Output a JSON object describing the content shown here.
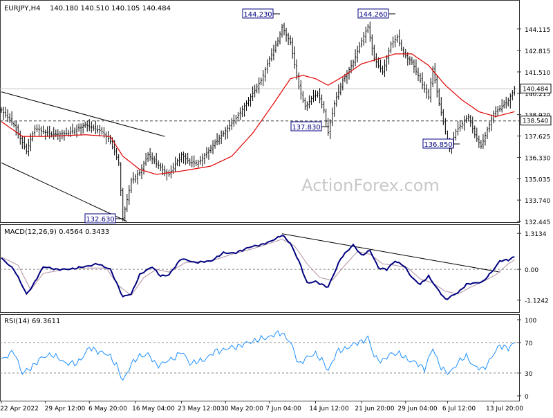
{
  "header": {
    "symbol": "EURJPY,H4",
    "ohlc": "140.180 140.510 140.105 140.484"
  },
  "watermark": "ActionForex.com",
  "colors": {
    "price": "#000000",
    "ma": "#e00000",
    "macd": "#000080",
    "signal": "#b090a0",
    "rsi": "#1e90ff",
    "grid": "#8a8a8a"
  },
  "chart_data": [
    {
      "type": "candlestick",
      "title": "EURJPY,H4  140.180 140.510 140.105 140.484",
      "ylim": [
        132.445,
        144.905
      ],
      "y_ticks": [
        "144.115",
        "142.815",
        "141.510",
        "140.215",
        "138.920",
        "137.625",
        "136.330",
        "135.035",
        "133.740",
        "132.445"
      ],
      "x_ticks": [
        "22 Apr 2022",
        "29 Apr 12:00",
        "6 May 20:00",
        "16 May 04:00",
        "23 May 12:00",
        "30 May 20:00",
        "7 Jun 04:00",
        "14 Jun 12:00",
        "21 Jun 20:00",
        "29 Jun 04:00",
        "6 Jul 12:00",
        "13 Jul 20:00"
      ],
      "current_price": "140.484",
      "support_level": "138.540",
      "annotations": [
        {
          "label": "132.630",
          "value": 132.63
        },
        {
          "label": "144.230",
          "value": 144.23
        },
        {
          "label": "137.830",
          "value": 137.83
        },
        {
          "label": "144.260",
          "value": 144.26
        },
        {
          "label": "136.850",
          "value": 136.85
        }
      ],
      "price_anchors": [
        [
          0,
          139.2
        ],
        [
          6,
          138.3
        ],
        [
          12,
          136.7
        ],
        [
          16,
          138.1
        ],
        [
          24,
          137.7
        ],
        [
          32,
          137.8
        ],
        [
          40,
          138.3
        ],
        [
          48,
          137.9
        ],
        [
          52,
          137.3
        ],
        [
          56,
          136.0
        ],
        [
          58,
          132.63
        ],
        [
          62,
          134.9
        ],
        [
          66,
          135.4
        ],
        [
          70,
          136.5
        ],
        [
          76,
          135.7
        ],
        [
          80,
          135.3
        ],
        [
          86,
          136.5
        ],
        [
          90,
          136.0
        ],
        [
          94,
          136.0
        ],
        [
          100,
          136.9
        ],
        [
          106,
          137.8
        ],
        [
          112,
          138.7
        ],
        [
          118,
          139.8
        ],
        [
          124,
          141.0
        ],
        [
          128,
          142.3
        ],
        [
          132,
          143.4
        ],
        [
          134,
          144.23
        ],
        [
          138,
          143.3
        ],
        [
          142,
          140.6
        ],
        [
          145,
          139.4
        ],
        [
          148,
          139.9
        ],
        [
          151,
          140.2
        ],
        [
          154,
          139.2
        ],
        [
          156,
          137.83
        ],
        [
          159,
          139.6
        ],
        [
          163,
          141.0
        ],
        [
          168,
          142.1
        ],
        [
          172,
          143.4
        ],
        [
          175,
          144.26
        ],
        [
          178,
          142.3
        ],
        [
          182,
          141.5
        ],
        [
          186,
          143.2
        ],
        [
          189,
          143.6
        ],
        [
          192,
          142.6
        ],
        [
          196,
          142.1
        ],
        [
          200,
          141.0
        ],
        [
          204,
          140.0
        ],
        [
          206,
          141.7
        ],
        [
          209,
          139.6
        ],
        [
          212,
          137.9
        ],
        [
          214,
          136.85
        ],
        [
          217,
          137.9
        ],
        [
          220,
          138.4
        ],
        [
          223,
          138.8
        ],
        [
          226,
          137.7
        ],
        [
          229,
          137.0
        ],
        [
          232,
          138.0
        ],
        [
          235,
          139.0
        ],
        [
          238,
          139.3
        ],
        [
          242,
          139.8
        ],
        [
          245,
          140.484
        ]
      ],
      "ma_anchors": [
        [
          0,
          138.5
        ],
        [
          10,
          137.6
        ],
        [
          20,
          137.6
        ],
        [
          40,
          137.7
        ],
        [
          52,
          137.6
        ],
        [
          58,
          136.4
        ],
        [
          66,
          135.6
        ],
        [
          74,
          135.3
        ],
        [
          86,
          135.5
        ],
        [
          100,
          135.8
        ],
        [
          110,
          136.4
        ],
        [
          120,
          137.8
        ],
        [
          130,
          139.6
        ],
        [
          138,
          141.1
        ],
        [
          144,
          141.3
        ],
        [
          150,
          141.1
        ],
        [
          156,
          140.7
        ],
        [
          164,
          141.3
        ],
        [
          172,
          142.0
        ],
        [
          180,
          142.3
        ],
        [
          188,
          142.6
        ],
        [
          196,
          142.6
        ],
        [
          204,
          141.9
        ],
        [
          212,
          140.7
        ],
        [
          220,
          139.8
        ],
        [
          228,
          139.1
        ],
        [
          236,
          138.8
        ],
        [
          245,
          139.1
        ]
      ],
      "trendlines": [
        {
          "from": [
            0,
            140.3
          ],
          "to": [
            78,
            137.6
          ]
        },
        {
          "from": [
            0,
            136.0
          ],
          "to": [
            60,
            132.445
          ]
        }
      ]
    },
    {
      "type": "line",
      "title": "MACD(12,26,9) 0.4564 0.3433",
      "ylim": [
        -1.36,
        1.42
      ],
      "y_ticks": [
        "1.3134",
        "0.00",
        "-1.1242"
      ],
      "series": [
        {
          "name": "MACD",
          "anchors": [
            [
              0,
              0.4
            ],
            [
              6,
              0.0
            ],
            [
              12,
              -0.9
            ],
            [
              15,
              -0.6
            ],
            [
              20,
              0.1
            ],
            [
              26,
              0.0
            ],
            [
              32,
              0.0
            ],
            [
              40,
              0.1
            ],
            [
              46,
              0.2
            ],
            [
              52,
              0.0
            ],
            [
              58,
              -1.0
            ],
            [
              62,
              -0.9
            ],
            [
              66,
              -0.2
            ],
            [
              72,
              0.1
            ],
            [
              76,
              -0.25
            ],
            [
              80,
              -0.2
            ],
            [
              86,
              0.4
            ],
            [
              92,
              0.25
            ],
            [
              100,
              0.3
            ],
            [
              106,
              0.6
            ],
            [
              112,
              0.6
            ],
            [
              118,
              0.8
            ],
            [
              124,
              0.9
            ],
            [
              128,
              1.0
            ],
            [
              134,
              1.25
            ],
            [
              138,
              0.95
            ],
            [
              142,
              0.3
            ],
            [
              146,
              -0.5
            ],
            [
              150,
              -0.45
            ],
            [
              156,
              -0.65
            ],
            [
              162,
              0.4
            ],
            [
              168,
              0.9
            ],
            [
              172,
              0.5
            ],
            [
              176,
              0.7
            ],
            [
              180,
              0.05
            ],
            [
              184,
              0.0
            ],
            [
              188,
              0.3
            ],
            [
              192,
              0.15
            ],
            [
              196,
              -0.3
            ],
            [
              200,
              -0.55
            ],
            [
              204,
              -0.25
            ],
            [
              208,
              -0.7
            ],
            [
              212,
              -1.1
            ],
            [
              218,
              -0.85
            ],
            [
              222,
              -0.55
            ],
            [
              226,
              -0.5
            ],
            [
              230,
              -0.45
            ],
            [
              234,
              -0.1
            ],
            [
              238,
              0.3
            ],
            [
              242,
              0.35
            ],
            [
              245,
              0.4564
            ]
          ]
        },
        {
          "name": "Signal",
          "anchors": [
            [
              0,
              0.45
            ],
            [
              8,
              0.15
            ],
            [
              14,
              -0.75
            ],
            [
              20,
              -0.15
            ],
            [
              30,
              0.0
            ],
            [
              40,
              0.05
            ],
            [
              50,
              0.05
            ],
            [
              56,
              -0.6
            ],
            [
              62,
              -0.95
            ],
            [
              68,
              -0.3
            ],
            [
              74,
              0.0
            ],
            [
              80,
              -0.1
            ],
            [
              88,
              0.25
            ],
            [
              100,
              0.3
            ],
            [
              110,
              0.55
            ],
            [
              120,
              0.75
            ],
            [
              128,
              0.95
            ],
            [
              134,
              1.1
            ],
            [
              140,
              0.85
            ],
            [
              146,
              0.2
            ],
            [
              152,
              -0.3
            ],
            [
              158,
              -0.4
            ],
            [
              164,
              0.15
            ],
            [
              170,
              0.65
            ],
            [
              176,
              0.55
            ],
            [
              182,
              0.2
            ],
            [
              188,
              0.15
            ],
            [
              194,
              0.05
            ],
            [
              200,
              -0.35
            ],
            [
              206,
              -0.5
            ],
            [
              212,
              -0.8
            ],
            [
              218,
              -0.9
            ],
            [
              224,
              -0.65
            ],
            [
              230,
              -0.45
            ],
            [
              236,
              -0.2
            ],
            [
              242,
              0.2
            ],
            [
              245,
              0.3433
            ]
          ]
        }
      ],
      "trendlines": [
        {
          "from": [
            134,
            1.3
          ],
          "to": [
            238,
            -0.1
          ]
        }
      ]
    },
    {
      "type": "line",
      "title": "RSI(14) 69.3611",
      "ylim": [
        0,
        100
      ],
      "y_ticks": [
        "100",
        "70",
        "30",
        "0"
      ],
      "levels": [
        70,
        30
      ],
      "series": [
        {
          "name": "RSI",
          "anchors": [
            [
              0,
              48
            ],
            [
              6,
              58
            ],
            [
              10,
              30
            ],
            [
              14,
              36
            ],
            [
              18,
              48
            ],
            [
              24,
              55
            ],
            [
              30,
              44
            ],
            [
              36,
              42
            ],
            [
              42,
              63
            ],
            [
              48,
              57
            ],
            [
              52,
              52
            ],
            [
              55,
              40
            ],
            [
              58,
              19
            ],
            [
              62,
              42
            ],
            [
              66,
              52
            ],
            [
              70,
              55
            ],
            [
              74,
              40
            ],
            [
              78,
              44
            ],
            [
              82,
              49
            ],
            [
              86,
              58
            ],
            [
              90,
              43
            ],
            [
              96,
              46
            ],
            [
              102,
              58
            ],
            [
              108,
              62
            ],
            [
              114,
              66
            ],
            [
              120,
              72
            ],
            [
              126,
              76
            ],
            [
              130,
              80
            ],
            [
              134,
              83
            ],
            [
              138,
              70
            ],
            [
              142,
              42
            ],
            [
              146,
              50
            ],
            [
              150,
              56
            ],
            [
              154,
              43
            ],
            [
              156,
              33
            ],
            [
              160,
              57
            ],
            [
              164,
              62
            ],
            [
              168,
              67
            ],
            [
              172,
              72
            ],
            [
              175,
              76
            ],
            [
              178,
              52
            ],
            [
              182,
              45
            ],
            [
              186,
              56
            ],
            [
              190,
              55
            ],
            [
              194,
              48
            ],
            [
              198,
              43
            ],
            [
              202,
              36
            ],
            [
              206,
              62
            ],
            [
              209,
              42
            ],
            [
              212,
              31
            ],
            [
              214,
              30
            ],
            [
              218,
              44
            ],
            [
              222,
              52
            ],
            [
              226,
              38
            ],
            [
              230,
              35
            ],
            [
              234,
              50
            ],
            [
              238,
              67
            ],
            [
              242,
              62
            ],
            [
              245,
              69.3611
            ]
          ]
        }
      ]
    }
  ]
}
